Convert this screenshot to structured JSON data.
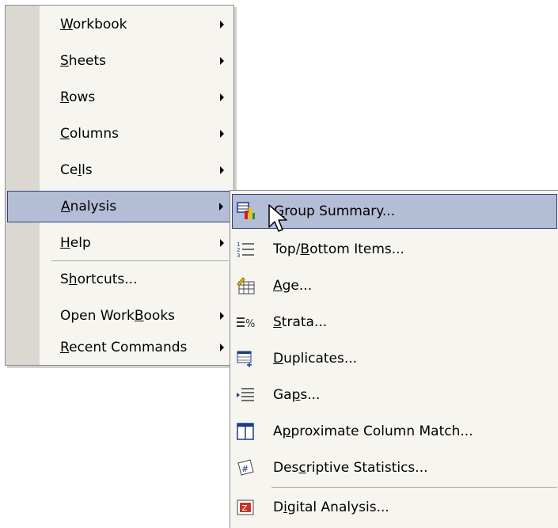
{
  "main_menu": {
    "items": [
      {
        "label": "Workbook",
        "mnemonic": 0,
        "arrow": true
      },
      {
        "label": "Sheets",
        "mnemonic": 0,
        "arrow": true
      },
      {
        "label": "Rows",
        "mnemonic": 0,
        "arrow": true
      },
      {
        "label": "Columns",
        "mnemonic": 0,
        "arrow": true
      },
      {
        "label": "Cells",
        "mnemonic": 2,
        "arrow": true
      },
      {
        "label": "Analysis",
        "mnemonic": 0,
        "arrow": true,
        "highlighted": true
      },
      {
        "label": "Help",
        "mnemonic": 0,
        "arrow": true
      },
      {
        "label": "Shortcuts...",
        "mnemonic": 1,
        "arrow": false
      },
      {
        "label": "Open WorkBooks",
        "mnemonic": 9,
        "arrow": true
      },
      {
        "label": "Recent Commands",
        "mnemonic": 0,
        "arrow": true
      }
    ]
  },
  "sub_menu": {
    "items": [
      {
        "label": "Group Summary...",
        "mnemonic": 0,
        "icon": "group-summary-icon",
        "highlighted": true
      },
      {
        "label": "Top/Bottom Items...",
        "mnemonic": 4,
        "icon": "top-bottom-icon"
      },
      {
        "label": "Age...",
        "mnemonic": 0,
        "icon": "age-icon"
      },
      {
        "label": "Strata...",
        "mnemonic": 0,
        "icon": "strata-icon"
      },
      {
        "label": "Duplicates...",
        "mnemonic": 0,
        "icon": "duplicates-icon"
      },
      {
        "label": "Gaps...",
        "mnemonic": 2,
        "icon": "gaps-icon"
      },
      {
        "label": "Approximate Column Match...",
        "mnemonic": 1,
        "icon": "column-match-icon"
      },
      {
        "label": "Descriptive Statistics...",
        "mnemonic": 3,
        "icon": "descriptive-statistics-icon"
      },
      {
        "label": "Digital Analysis...",
        "mnemonic": 1,
        "icon": "digital-analysis-icon"
      }
    ]
  },
  "colors": {
    "menu_bg": "#f6f5f0",
    "gutter": "#dbd8d1",
    "highlight_bg": "#b4bdd6",
    "highlight_border": "#31427a"
  }
}
